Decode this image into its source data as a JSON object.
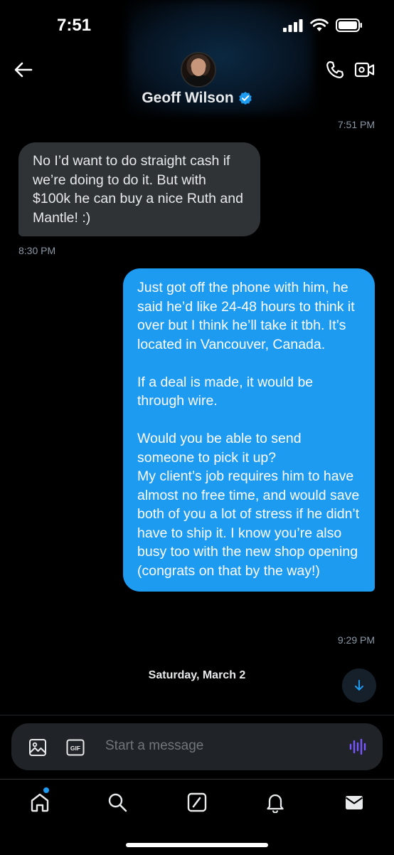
{
  "status_bar": {
    "time": "7:51"
  },
  "header": {
    "contact_name": "Geoff Wilson",
    "verified": true
  },
  "messages": {
    "top_timestamp": "7:51 PM",
    "received": {
      "text": "No I’d want to do straight cash if we’re doing to do it. But with $100k he can buy a nice Ruth and Mantle! :)",
      "timestamp": "8:30 PM"
    },
    "sent": {
      "text": "Just got off the phone with him, he said he’d like 24-48 hours to think it over but I think he’ll take it tbh. It’s located in Vancouver, Canada.\n\nIf a deal is made, it would be through wire.\n\nWould you be able to send someone to pick it up?\nMy client’s job requires him to have almost no free time, and would save both of you a lot of stress if he didn’t have to ship it. I know you’re also busy too with the new shop opening (congrats on that by the way!)",
      "timestamp": "9:29 PM"
    },
    "date_separator": "Saturday, March 2"
  },
  "composer": {
    "placeholder": "Start a message",
    "gif_label": "GIF"
  },
  "colors": {
    "accent": "#1d9bf0",
    "received_bubble": "#2f3336",
    "background": "#000000",
    "voice": "#7856ff"
  },
  "tabs": [
    {
      "icon": "home-icon",
      "has_badge": true
    },
    {
      "icon": "search-icon"
    },
    {
      "icon": "compose-icon"
    },
    {
      "icon": "bell-icon"
    },
    {
      "icon": "mail-icon"
    }
  ]
}
